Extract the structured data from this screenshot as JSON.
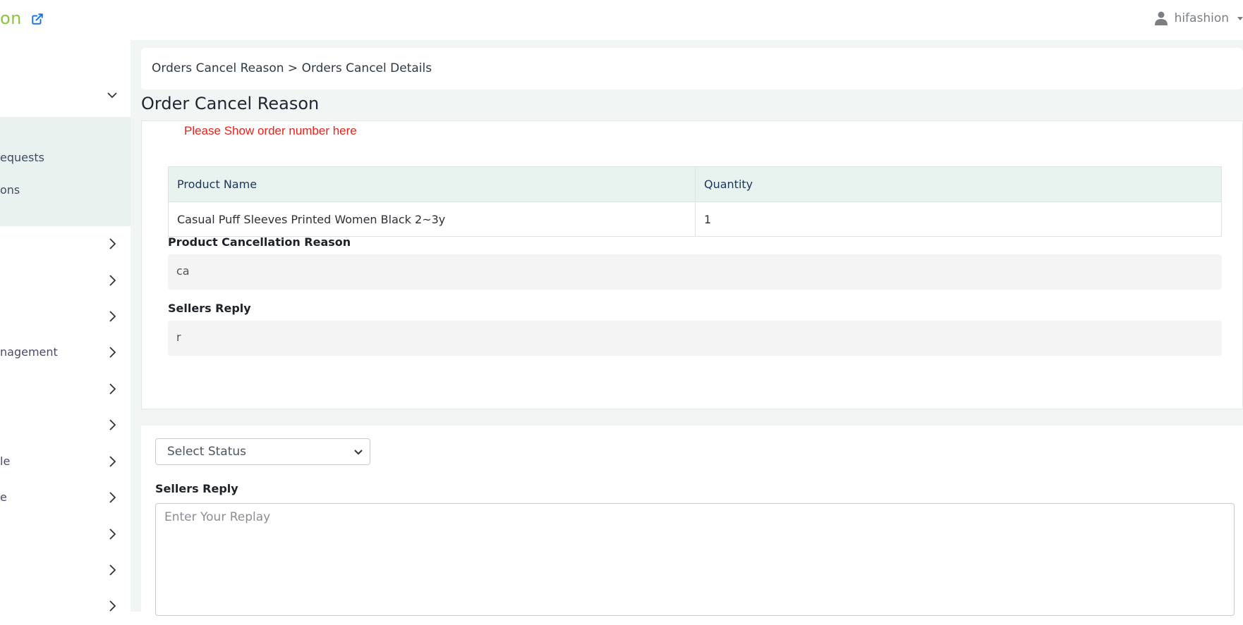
{
  "topbar": {
    "brand_text": "on",
    "username": "hifashion"
  },
  "sidebar": {
    "sub_items": [
      "equests",
      "ons"
    ],
    "items": [
      "",
      "",
      "",
      "nagement",
      "",
      "",
      "le",
      "e",
      "",
      "",
      ""
    ]
  },
  "breadcrumb": {
    "text": "Orders Cancel Reason > Orders Cancel Details"
  },
  "page": {
    "title": "Order Cancel Reason",
    "notice": "Please Show order number here"
  },
  "product_table": {
    "headers": [
      "Product Name",
      "Quantity"
    ],
    "rows": [
      [
        "Casual Puff Sleeves Printed Women Black 2~3y",
        "1"
      ]
    ]
  },
  "cancellation": {
    "label": "Product Cancellation Reason",
    "value": "ca"
  },
  "seller_reply_display": {
    "label": "Sellers Reply",
    "value": "r"
  },
  "reply_form": {
    "status_select": "Select Status",
    "label": "Sellers Reply",
    "placeholder": "Enter Your Replay"
  },
  "colors": {
    "brand": "#8ac53f",
    "notice": "#e8231a",
    "table_header_bg": "#e8f2ef",
    "sidebar_active_bg": "#e9f2ef"
  }
}
